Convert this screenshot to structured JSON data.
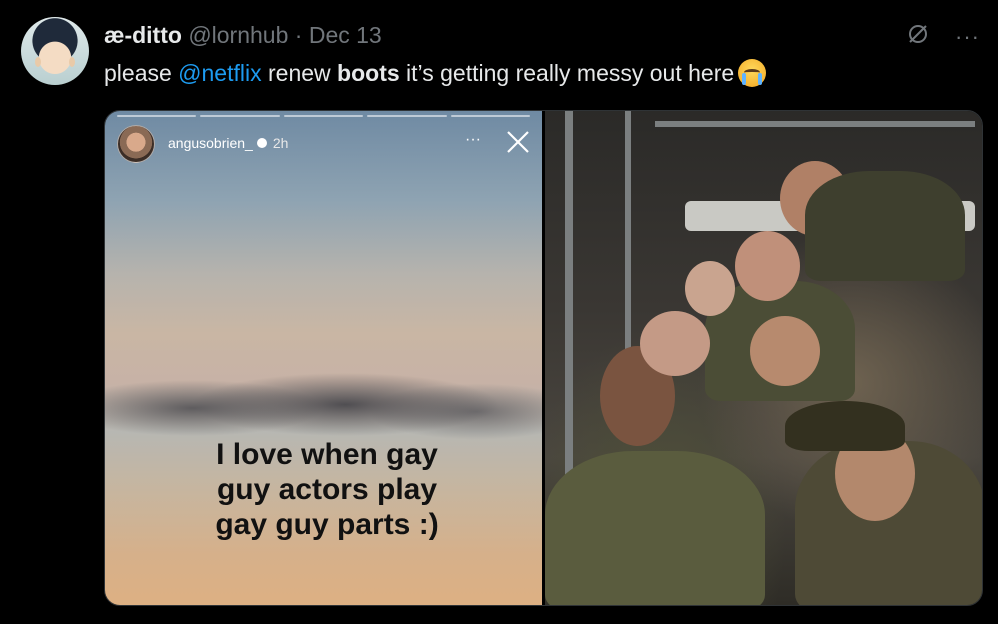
{
  "author": {
    "name": "æ-ditto",
    "handle": "@lornhub",
    "separator": "·",
    "date": "Dec 13"
  },
  "tweet": {
    "text_before_mention": "please ",
    "mention": "@netflix",
    "text_after_mention": " renew ",
    "bold_word": "boots",
    "text_end": " it’s getting really messy out here"
  },
  "actions": {
    "more_label": "···"
  },
  "icons": [
    "avatar",
    "crying-face-emoji-icon",
    "grok-icon",
    "more-icon",
    "verified-icon",
    "close-icon"
  ],
  "media": {
    "story": {
      "username": "angusobrien_",
      "time": "2h",
      "more": "···",
      "caption_lines": [
        "I love when gay",
        "guy actors play",
        "gay guy parts :)"
      ]
    }
  },
  "colors": {
    "background": "#000000",
    "text": "#e7e9ea",
    "muted": "#71767b",
    "link": "#1d9bf0"
  }
}
